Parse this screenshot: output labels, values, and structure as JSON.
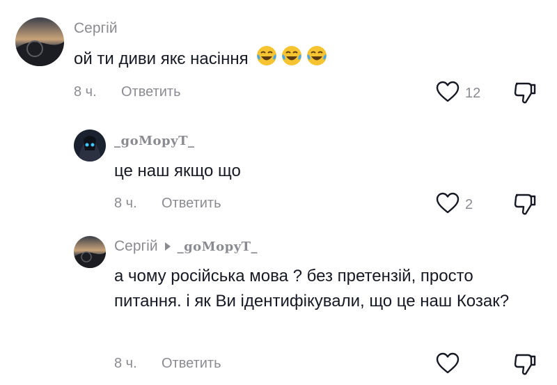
{
  "comments": [
    {
      "username": "Сергій",
      "text": "ой ти диви якє насіння",
      "emoji": [
        "face-with-tears-of-joy",
        "face-with-tears-of-joy",
        "face-with-tears-of-joy"
      ],
      "time": "8 ч.",
      "reply_label": "Ответить",
      "likes": "12"
    },
    {
      "username": "_goMopyT_",
      "text": "це наш якщо що",
      "time": "8 ч.",
      "reply_label": "Ответить",
      "likes": "2"
    },
    {
      "username": "Сергій",
      "reply_to": "_goMopyT_",
      "text": "а чому російська мова ? без претензій, просто питання. і як Ви ідентифікували, що це наш Козак?",
      "time": "8 ч.",
      "reply_label": "Ответить",
      "likes": ""
    }
  ],
  "icons": {
    "like": "heart-outline-icon",
    "dislike": "thumbs-down-outline-icon",
    "reply_arrow": "caret-right-icon"
  },
  "colors": {
    "text": "#161823",
    "secondary": "#8a8b91",
    "emoji_face": "#f7c431"
  }
}
